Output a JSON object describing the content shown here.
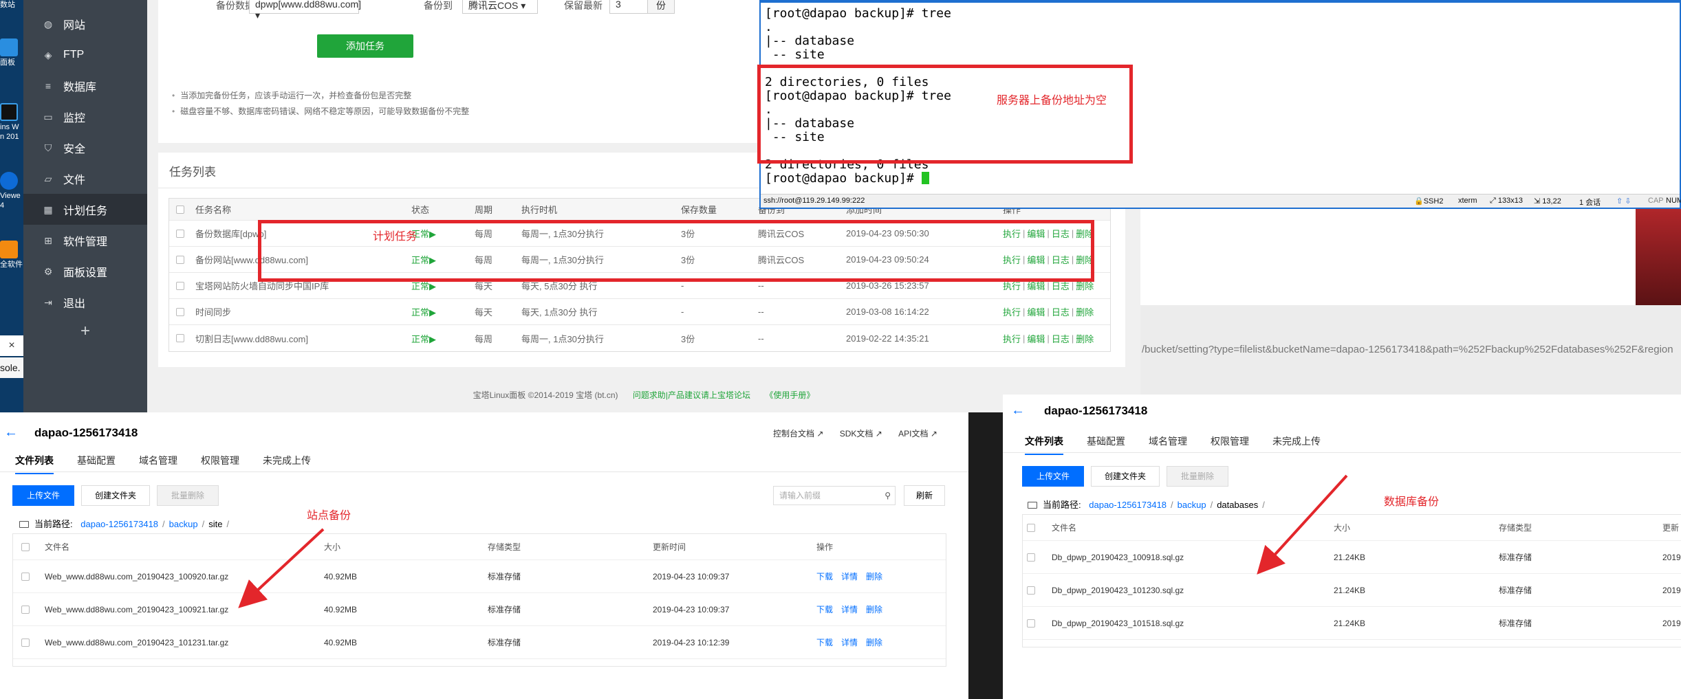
{
  "desktop": {
    "icons": [
      {
        "label": "数站"
      },
      {
        "label": "面板"
      },
      {
        "label": "ins W"
      },
      {
        "label": "n 201"
      },
      {
        "label": "Viewe"
      },
      {
        "label": "4"
      },
      {
        "label": "全软件"
      }
    ],
    "close_glyph": "×",
    "console_text": "sole."
  },
  "bt_sidebar": {
    "items": [
      {
        "label": "网站",
        "icon": "globe-icon"
      },
      {
        "label": "FTP",
        "icon": "ftp-icon"
      },
      {
        "label": "数据库",
        "icon": "database-icon"
      },
      {
        "label": "监控",
        "icon": "monitor-icon"
      },
      {
        "label": "安全",
        "icon": "shield-icon"
      },
      {
        "label": "文件",
        "icon": "folder-icon"
      },
      {
        "label": "计划任务",
        "icon": "calendar-icon",
        "active": true
      },
      {
        "label": "软件管理",
        "icon": "grid-icon"
      },
      {
        "label": "面板设置",
        "icon": "gear-icon"
      },
      {
        "label": "退出",
        "icon": "logout-icon"
      }
    ],
    "add_glyph": "+"
  },
  "bt_form": {
    "db_label": "备份数据库",
    "db_value": "dpwp[www.dd88wu.com]",
    "backup_to_label": "备份到",
    "backup_to_value": "腾讯云COS",
    "keep_label": "保留最新",
    "keep_value": "3",
    "keep_unit": "份",
    "add_task_button": "添加任务",
    "tips": [
      "当添加完备份任务，应该手动运行一次，并检查备份包是否完整",
      "磁盘容量不够、数据库密码错误、网络不稳定等原因，可能导致数据备份不完整"
    ]
  },
  "task_list": {
    "title": "任务列表",
    "columns": [
      "任务名称",
      "状态",
      "周期",
      "执行时机",
      "保存数量",
      "备份到",
      "添加时间",
      "操作"
    ],
    "rows": [
      {
        "name": "备份数据库[dpwp]",
        "status": "正常▶",
        "cycle": "每周",
        "time": "每周一, 1点30分执行",
        "keep": "3份",
        "backup_to": "腾讯云COS",
        "added": "2019-04-23 09:50:30"
      },
      {
        "name": "备份网站[www.dd88wu.com]",
        "status": "正常▶",
        "cycle": "每周",
        "time": "每周一, 1点30分执行",
        "keep": "3份",
        "backup_to": "腾讯云COS",
        "added": "2019-04-23 09:50:24"
      },
      {
        "name": "宝塔网站防火墙自动同步中国IP库",
        "status": "正常▶",
        "cycle": "每天",
        "time": "每天, 5点30分 执行",
        "keep": "-",
        "backup_to": "--",
        "added": "2019-03-26 15:23:57"
      },
      {
        "name": "时间同步",
        "status": "正常▶",
        "cycle": "每天",
        "time": "每天, 1点30分 执行",
        "keep": "-",
        "backup_to": "--",
        "added": "2019-03-08 16:14:22"
      },
      {
        "name": "切割日志[www.dd88wu.com]",
        "status": "正常▶",
        "cycle": "每周",
        "time": "每周一, 1点30分执行",
        "keep": "3份",
        "backup_to": "--",
        "added": "2019-02-22 14:35:21"
      }
    ],
    "ops": {
      "run": "执行",
      "edit": "编辑",
      "log": "日志",
      "delete": "删除",
      "sep": "|"
    }
  },
  "bt_footer": {
    "copyright": "宝塔Linux面板 ©2014-2019 宝塔 (bt.cn)",
    "forum": "问题求助|产品建议请上宝塔论坛",
    "manual": "《使用手册》"
  },
  "annotations": {
    "scheduled": "计划任务",
    "server_empty": "服务器上备份地址为空",
    "site_backup": "站点备份",
    "db_backup": "数据库备份"
  },
  "terminal": {
    "lines": [
      "[root@dapao backup]# tree",
      ".",
      "|-- database",
      " -- site",
      "",
      "2 directories, 0 files",
      "[root@dapao backup]# tree",
      ".",
      "|-- database",
      " -- site",
      "",
      "2 directories, 0 files"
    ],
    "prompt": "[root@dapao backup]# ",
    "status": {
      "session": "ssh://root@119.29.149.99:222",
      "protocol": "SSH2",
      "term": "xterm",
      "size": "133x13",
      "pos": "13,22",
      "sessions": "1 会话",
      "caps": "CAP",
      "num": "NUM"
    }
  },
  "browser_url": "/bucket/setting?type=filelist&bucketName=dapao-1256173418&path=%252Fbackup%252Fdatabases%252F&region",
  "cos_left": {
    "bucket": "dapao-1256173418",
    "doc_links": [
      "控制台文档 ↗",
      "SDK文档 ↗",
      "API文档 ↗"
    ],
    "tabs": [
      "文件列表",
      "基础配置",
      "域名管理",
      "权限管理",
      "未完成上传"
    ],
    "upload_button": "上传文件",
    "new_folder_button": "创建文件夹",
    "batch_delete_button": "批量删除",
    "search_placeholder": "请输入前缀",
    "refresh_button": "刷新",
    "path_label": "当前路径:",
    "path": [
      "dapao-1256173418",
      "backup",
      "site",
      ""
    ],
    "columns": [
      "文件名",
      "大小",
      "存储类型",
      "更新时间",
      "操作"
    ],
    "files": [
      {
        "name": "Web_www.dd88wu.com_20190423_100920.tar.gz",
        "size": "40.92MB",
        "storage": "标准存储",
        "updated": "2019-04-23 10:09:37"
      },
      {
        "name": "Web_www.dd88wu.com_20190423_100921.tar.gz",
        "size": "40.92MB",
        "storage": "标准存储",
        "updated": "2019-04-23 10:09:37"
      },
      {
        "name": "Web_www.dd88wu.com_20190423_101231.tar.gz",
        "size": "40.92MB",
        "storage": "标准存储",
        "updated": "2019-04-23 10:12:39"
      }
    ],
    "ops": [
      "下载",
      "详情",
      "删除"
    ]
  },
  "cos_right": {
    "bucket": "dapao-1256173418",
    "tabs": [
      "文件列表",
      "基础配置",
      "域名管理",
      "权限管理",
      "未完成上传"
    ],
    "upload_button": "上传文件",
    "new_folder_button": "创建文件夹",
    "batch_delete_button": "批量删除",
    "path_label": "当前路径:",
    "path": [
      "dapao-1256173418",
      "backup",
      "databases",
      ""
    ],
    "columns": [
      "文件名",
      "大小",
      "存储类型",
      "更新"
    ],
    "files": [
      {
        "name": "Db_dpwp_20190423_100918.sql.gz",
        "size": "21.24KB",
        "storage": "标准存储",
        "updated": "2019"
      },
      {
        "name": "Db_dpwp_20190423_101230.sql.gz",
        "size": "21.24KB",
        "storage": "标准存储",
        "updated": "2019"
      },
      {
        "name": "Db_dpwp_20190423_101518.sql.gz",
        "size": "21.24KB",
        "storage": "标准存储",
        "updated": "2019"
      }
    ]
  },
  "colors": {
    "bt_green": "#20a53a",
    "cos_blue": "#006eff",
    "annotation_red": "#e3262b",
    "sidebar": "#3c444d"
  }
}
